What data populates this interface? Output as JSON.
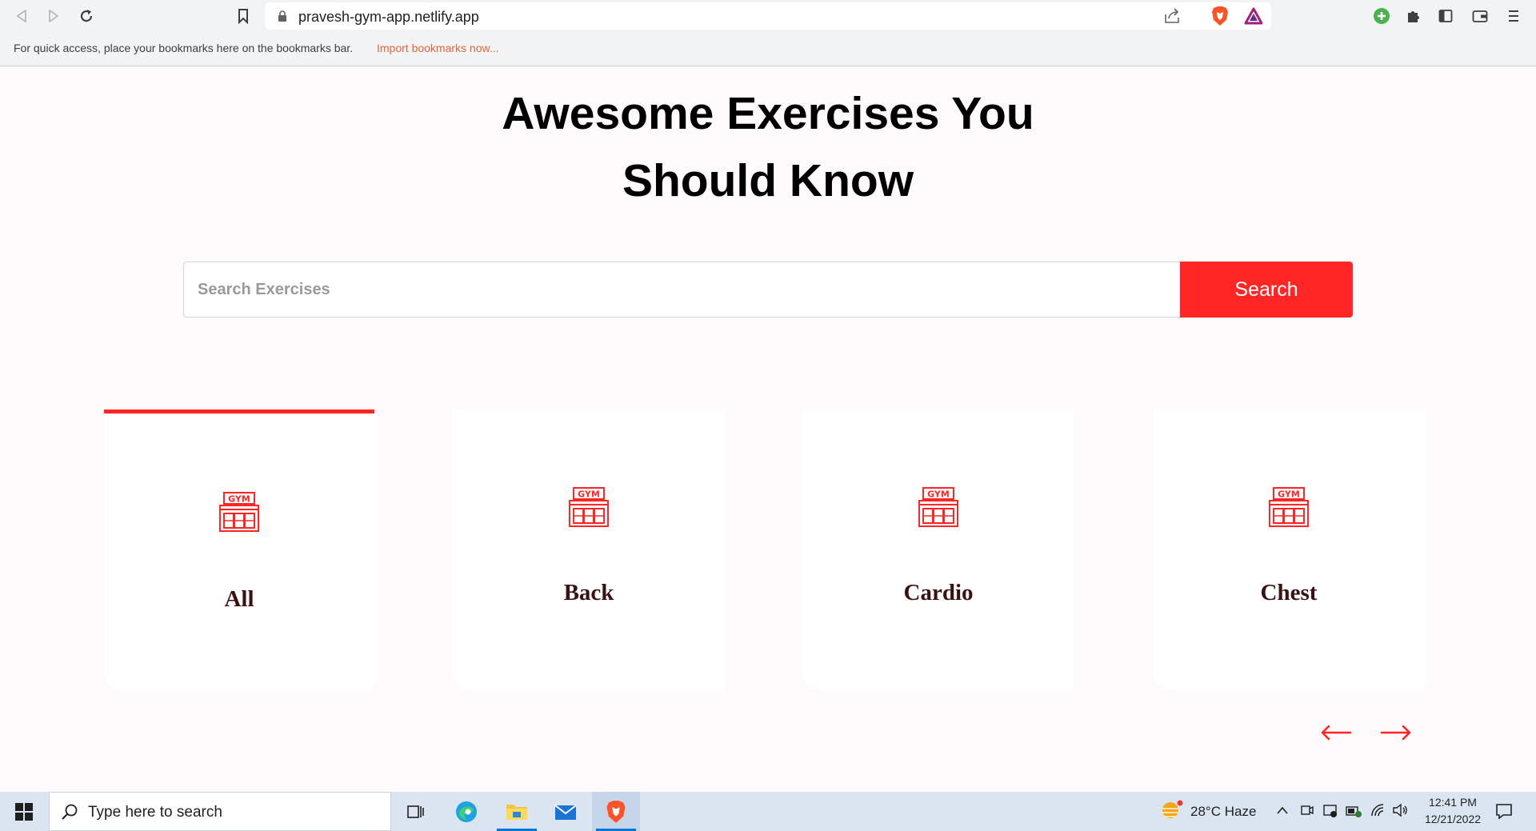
{
  "browser": {
    "url": "pravesh-gym-app.netlify.app",
    "bookmarks_message": "For quick access, place your bookmarks here on the bookmarks bar.",
    "bookmarks_import_link": "Import bookmarks now..."
  },
  "hero": {
    "title_line1": "Awesome Exercises You",
    "title_line2": "Should Know"
  },
  "search": {
    "placeholder": "Search Exercises",
    "button_label": "Search"
  },
  "categories": [
    {
      "label": "All",
      "icon": "gym-icon",
      "selected": true
    },
    {
      "label": "Back",
      "icon": "gym-icon",
      "selected": false
    },
    {
      "label": "Cardio",
      "icon": "gym-icon",
      "selected": false
    },
    {
      "label": "Chest",
      "icon": "gym-icon",
      "selected": false
    }
  ],
  "icon_text": "GYM",
  "carousel": {
    "prev_icon": "arrow-left-icon",
    "next_icon": "arrow-right-icon"
  },
  "taskbar": {
    "search_placeholder": "Type here to search",
    "weather": "28°C  Haze",
    "time": "12:41 PM",
    "date": "12/21/2022"
  },
  "colors": {
    "accent": "#ff2625",
    "page_background": "#fffafb",
    "card_label": "#3a1212"
  }
}
